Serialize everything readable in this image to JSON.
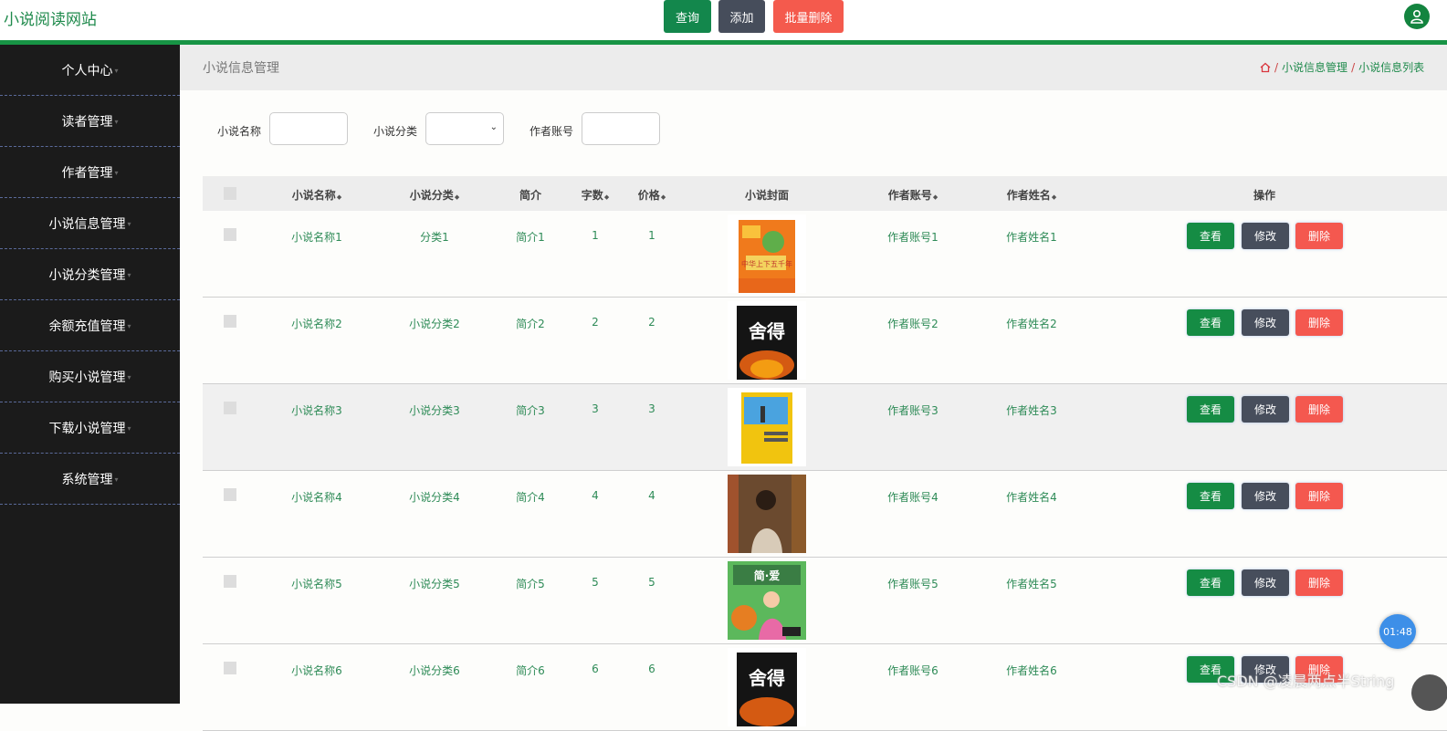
{
  "app": {
    "brand": "小说阅读网站"
  },
  "sidebar": {
    "items": [
      {
        "label": "个人中心"
      },
      {
        "label": "读者管理"
      },
      {
        "label": "作者管理"
      },
      {
        "label": "小说信息管理"
      },
      {
        "label": "小说分类管理"
      },
      {
        "label": "余额充值管理"
      },
      {
        "label": "购买小说管理"
      },
      {
        "label": "下载小说管理"
      },
      {
        "label": "系统管理"
      }
    ]
  },
  "header": {
    "title": "小说信息管理",
    "breadcrumb": [
      "小说信息管理",
      "小说信息列表"
    ]
  },
  "search": {
    "name_label": "小说名称",
    "category_label": "小说分类",
    "author_account_label": "作者账号",
    "query_button": "查询",
    "add_button": "添加",
    "batch_delete_button": "批量删除"
  },
  "table": {
    "columns": [
      "小说名称",
      "小说分类",
      "简介",
      "字数",
      "价格",
      "小说封面",
      "作者账号",
      "作者姓名",
      "操作"
    ],
    "actions": {
      "view": "查看",
      "edit": "修改",
      "delete": "删除"
    },
    "rows": [
      {
        "name": "小说名称1",
        "category": "分类1",
        "intro": "简介1",
        "words": "1",
        "price": "1",
        "account": "作者账号1",
        "author": "作者姓名1",
        "cover_text": "中华上下五千年"
      },
      {
        "name": "小说名称2",
        "category": "小说分类2",
        "intro": "简介2",
        "words": "2",
        "price": "2",
        "account": "作者账号2",
        "author": "作者姓名2",
        "cover_text": "舍得"
      },
      {
        "name": "小说名称3",
        "category": "小说分类3",
        "intro": "简介3",
        "words": "3",
        "price": "3",
        "account": "作者账号3",
        "author": "作者姓名3",
        "cover_text": ""
      },
      {
        "name": "小说名称4",
        "category": "小说分类4",
        "intro": "简介4",
        "words": "4",
        "price": "4",
        "account": "作者账号4",
        "author": "作者姓名4",
        "cover_text": ""
      },
      {
        "name": "小说名称5",
        "category": "小说分类5",
        "intro": "简介5",
        "words": "5",
        "price": "5",
        "account": "作者账号5",
        "author": "作者姓名5",
        "cover_text": "简·爱"
      },
      {
        "name": "小说名称6",
        "category": "小说分类6",
        "intro": "简介6",
        "words": "6",
        "price": "6",
        "account": "作者账号6",
        "author": "作者姓名6",
        "cover_text": "舍得"
      }
    ]
  },
  "overlay": {
    "timer": "01:48",
    "watermark": "CSDN @凌晨两点半String"
  },
  "colors": {
    "brand_green": "#179445",
    "sidebar_bg": "#1b1b1b",
    "view_button": "#158c44",
    "edit_button": "#474e5c",
    "delete_button": "#f4584f"
  }
}
